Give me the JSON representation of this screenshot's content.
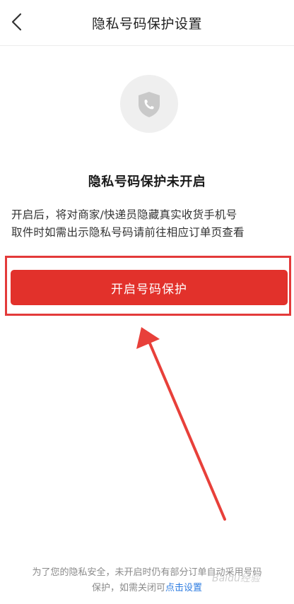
{
  "header": {
    "title": "隐私号码保护设置",
    "back_icon": "chevron-left-icon"
  },
  "status": {
    "icon": "shield-phone-icon",
    "title": "隐私号码保护未开启",
    "description_line1": "开启后，将对商家/快递员隐藏真实收货手机号",
    "description_line2": "取件时如需出示隐私号码请前往相应订单页查看"
  },
  "actions": {
    "enable_label": "开启号码保护"
  },
  "footer": {
    "line1": "为了您的隐私安全，未开启时仍有部分订单自动采用号码",
    "line2_prefix": "保护，如需关闭可",
    "link_label": "点击设置"
  },
  "watermark": {
    "text": "Baidu经验"
  },
  "colors": {
    "accent": "#e2312b",
    "annotation": "#e33a3a",
    "link": "#2f7de1"
  }
}
